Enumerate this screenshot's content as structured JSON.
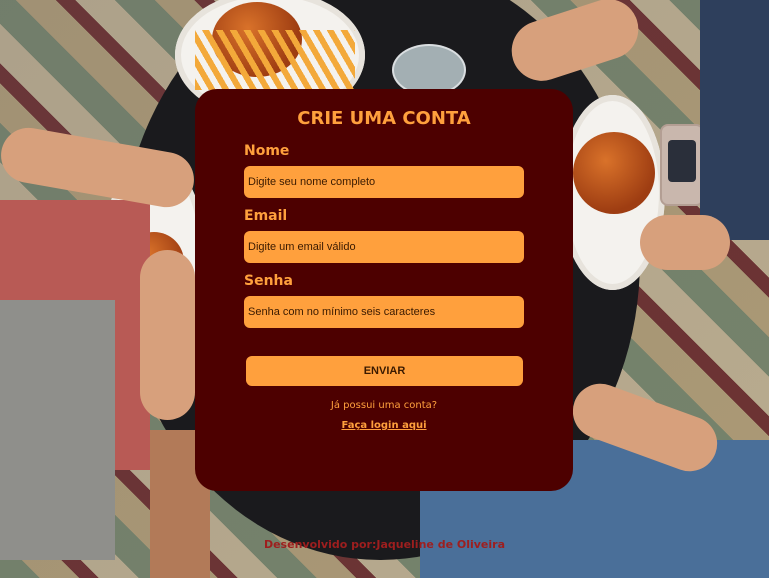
{
  "form": {
    "title": "CRIE UMA CONTA",
    "name_label": "Nome",
    "name_placeholder": "Digite seu nome completo",
    "email_label": "Email",
    "email_placeholder": "Digite um email válido",
    "password_label": "Senha",
    "password_placeholder": "Senha com no mínimo seis caracteres",
    "submit_label": "ENVIAR",
    "account_prompt": "Já possui uma conta?",
    "login_link": "Faça login aqui"
  },
  "footer": {
    "credit": "Desenvolvido por:Jaqueline de Oliveira"
  },
  "colors": {
    "card": "#4d0000",
    "accent": "#ffa03d",
    "footer_text": "#9e1e1e"
  }
}
